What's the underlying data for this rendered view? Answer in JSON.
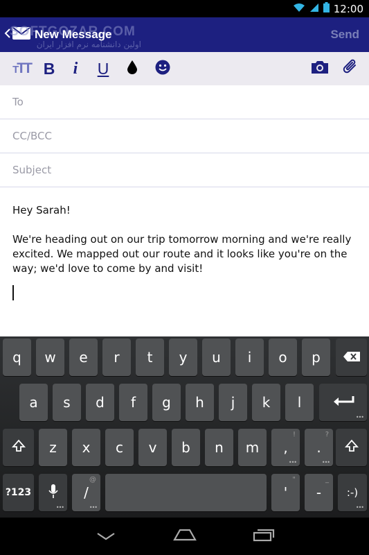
{
  "status_bar": {
    "time": "12:00"
  },
  "header": {
    "title": "New Message",
    "send_label": "Send",
    "watermark_en": "SOFTGOZAR.COM",
    "watermark_fa": "اولین دانشنامه نرم افزار ایران"
  },
  "toolbar": {
    "icons": [
      "text-size-icon",
      "bold-icon",
      "italic-icon",
      "underline-icon",
      "text-color-icon",
      "emoji-icon",
      "camera-icon",
      "attach-icon"
    ],
    "bold_label": "B",
    "italic_label": "i",
    "underline_label": "U",
    "text_size_label": "TT"
  },
  "form": {
    "to_placeholder": "To",
    "cc_placeholder": "CC/BCC",
    "subject_placeholder": "Subject",
    "body_greeting": "Hey Sarah!",
    "body_text": "We're heading out on our trip tomorrow morning and we're really excited. We mapped out our route and it looks like you're on the way; we'd love to come by and visit!"
  },
  "keyboard": {
    "row1": [
      "q",
      "w",
      "e",
      "r",
      "t",
      "y",
      "u",
      "i",
      "o",
      "p"
    ],
    "row2": [
      "a",
      "s",
      "d",
      "f",
      "g",
      "h",
      "j",
      "k",
      "l"
    ],
    "row3": [
      "z",
      "x",
      "c",
      "v",
      "b",
      "n",
      "m",
      ",",
      "."
    ],
    "row3_hints": [
      "",
      "",
      "",
      "",
      "",
      "",
      "",
      "!",
      "?"
    ],
    "symbols_label": "?123",
    "slash_label": "/",
    "slash_hint": "@",
    "apostrophe_label": "'",
    "apostrophe_hint": "\"",
    "dash_label": "-",
    "dash_hint": "_",
    "smiley_label": ":-)"
  },
  "colors": {
    "header_bg": "#1d2080",
    "toolbar_bg": "#eceaf0",
    "accent": "#1d2080",
    "key_bg": "#505254"
  }
}
